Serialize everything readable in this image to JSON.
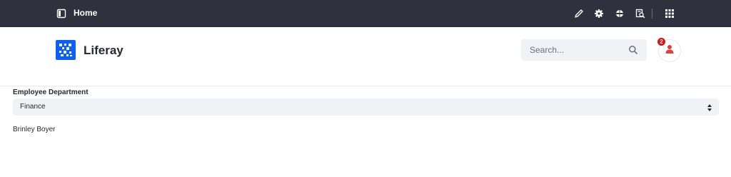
{
  "control_bar": {
    "page_title": "Home",
    "icons": [
      "sidebar-toggle-icon",
      "pencil-icon",
      "gear-icon",
      "simulation-icon",
      "page-audit-icon",
      "apps-grid-icon"
    ]
  },
  "header": {
    "site_name": "Liferay",
    "search_placeholder": "Search...",
    "notification_count": "2"
  },
  "form": {
    "field_label": "Employee Department",
    "selected_option": "Finance"
  },
  "results": {
    "employee_name": "Brinley Boyer"
  },
  "colors": {
    "control_bar_bg": "#30313f",
    "logo_blue": "#0b5fff",
    "badge_red": "#da1414",
    "avatar_red": "#e53e3e"
  }
}
